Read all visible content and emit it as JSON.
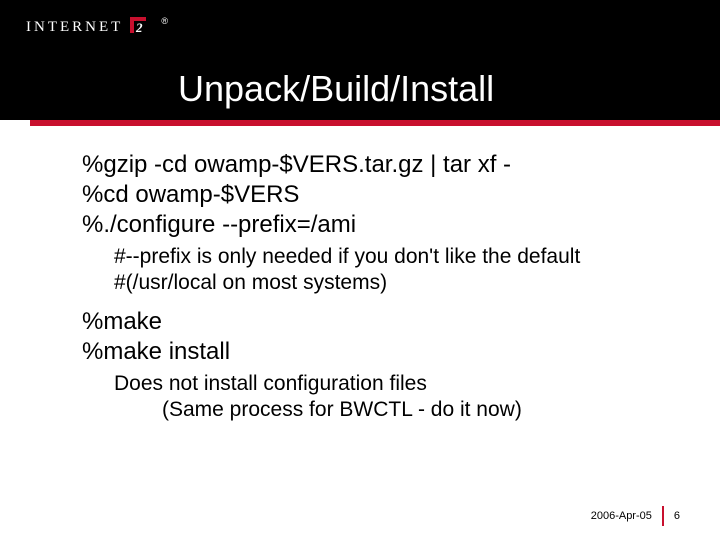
{
  "logo": {
    "word": "INTERNET",
    "digit": "2",
    "reg": "®"
  },
  "title": "Unpack/Build/Install",
  "body": {
    "cmd1": "%gzip -cd owamp-$VERS.tar.gz | tar xf -",
    "cmd2": "%cd owamp-$VERS",
    "cmd3": "%./configure --prefix=/ami",
    "note1a": "#--prefix is only needed if you don't like the default",
    "note1b": "#(/usr/local on most systems)",
    "cmd4": "%make",
    "cmd5": "%make install",
    "note2": "Does not install configuration files",
    "note3": "(Same process for BWCTL - do it now)"
  },
  "footer": {
    "date": "2006-Apr-05",
    "page": "6"
  }
}
